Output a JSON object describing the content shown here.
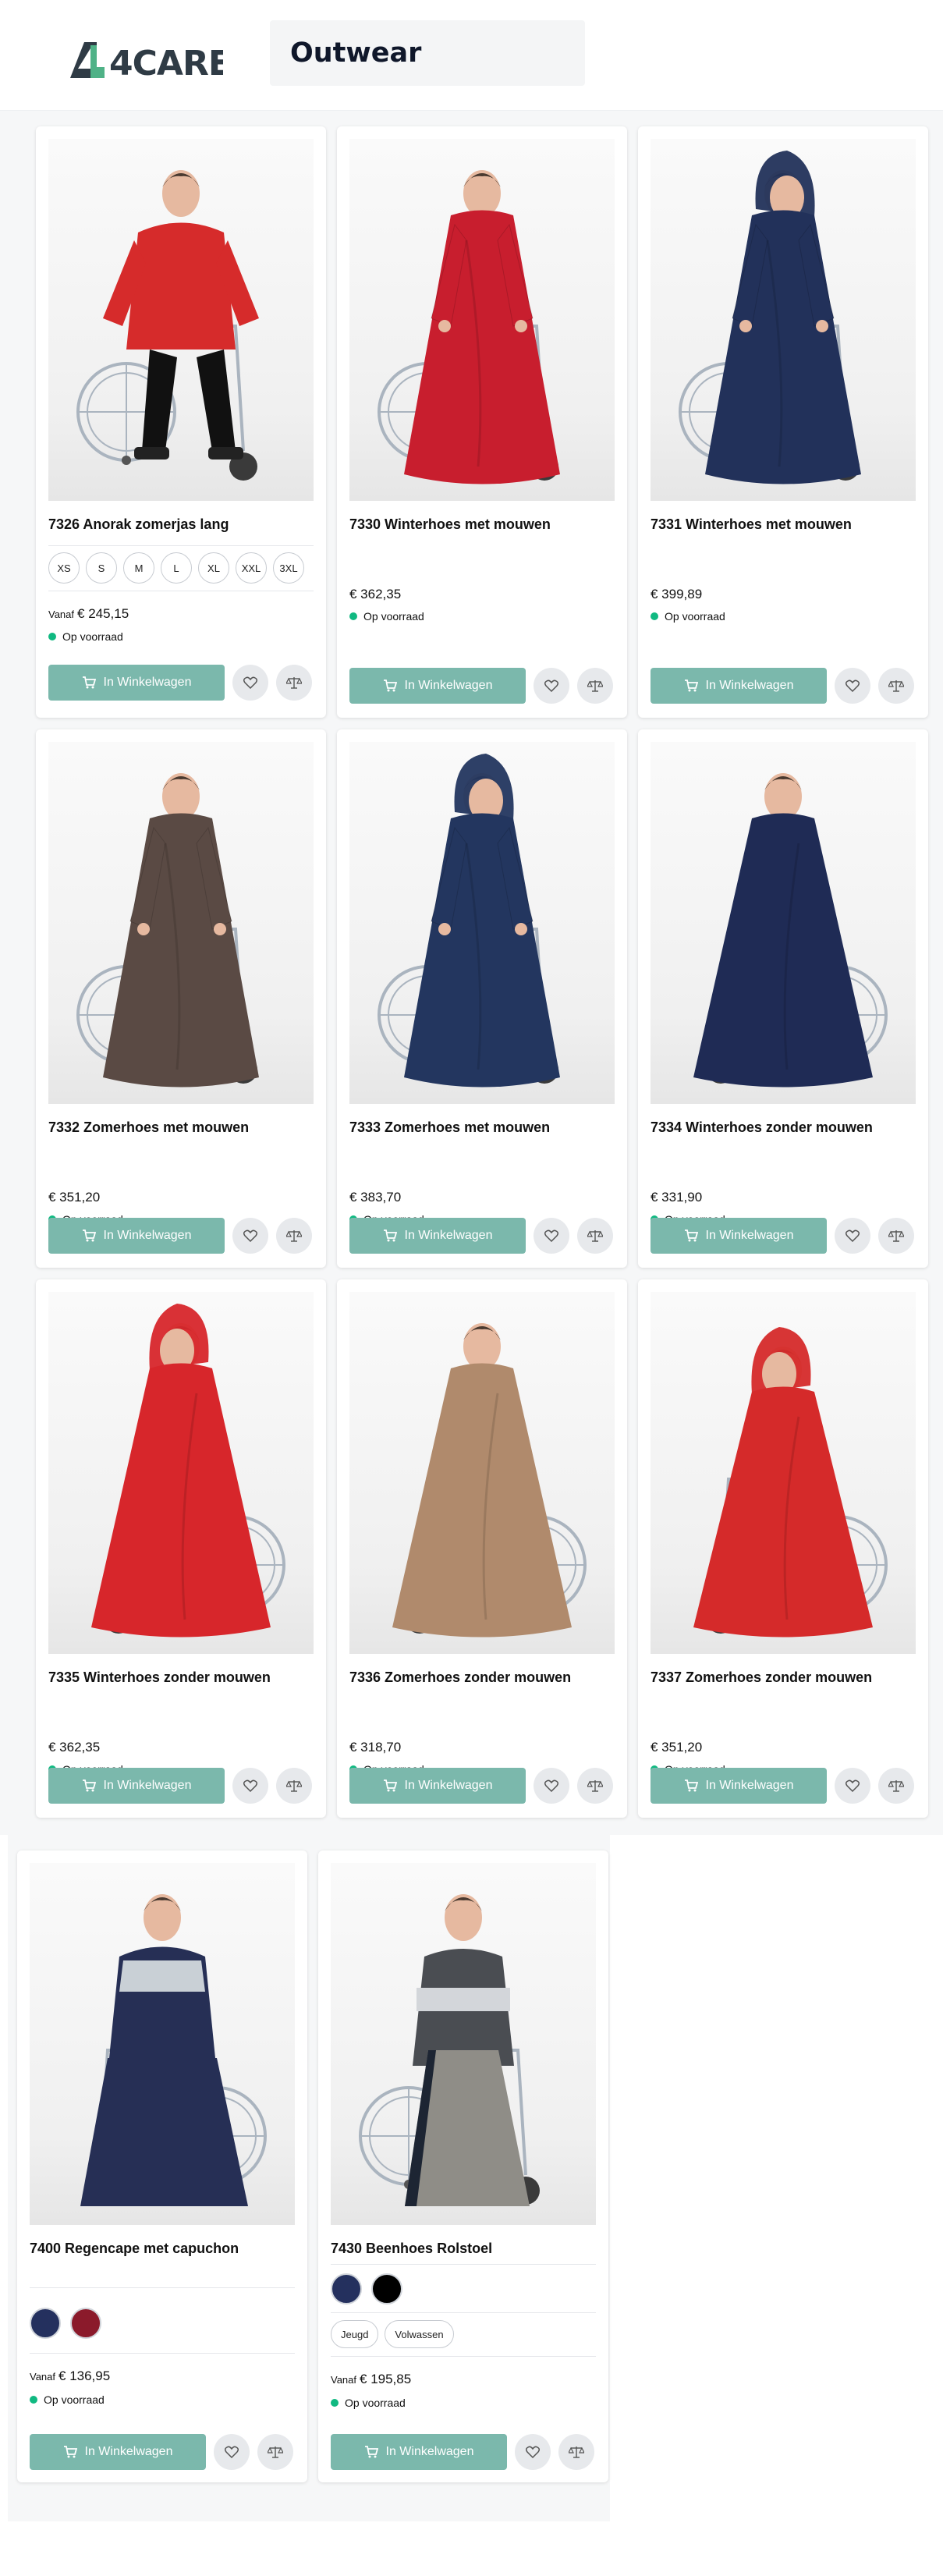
{
  "header": {
    "brand": "4CARE",
    "page_title": "Outwear"
  },
  "labels": {
    "cart": "In Winkelwagen",
    "from": "Vanaf",
    "stock": "Op voorraad"
  },
  "colors": {
    "cart_button": "#7bb8ac",
    "stock_dot": "#10b981",
    "swatch_navy": "#24305e",
    "swatch_burgundy": "#8b1a2b",
    "swatch_black": "#000000"
  },
  "products": [
    {
      "name": "7326 Anorak zomerjas lang",
      "price": "€ 245,15",
      "sizes": [
        "XS",
        "S",
        "M",
        "L",
        "XL",
        "XXL",
        "3XL"
      ]
    },
    {
      "name": "7330 Winterhoes met mouwen",
      "price": "€ 362,35"
    },
    {
      "name": "7331 Winterhoes met mouwen",
      "price": "€ 399,89"
    },
    {
      "name": "7332 Zomerhoes met mouwen",
      "price": "€ 351,20"
    },
    {
      "name": "7333 Zomerhoes met mouwen",
      "price": "€ 383,70"
    },
    {
      "name": "7334 Winterhoes zonder mouwen",
      "price": "€ 331,90"
    },
    {
      "name": "7335 Winterhoes zonder mouwen",
      "price": "€ 362,35"
    },
    {
      "name": "7336 Zomerhoes zonder mouwen",
      "price": "€ 318,70"
    },
    {
      "name": "7337 Zomerhoes zonder mouwen",
      "price": "€ 351,20"
    },
    {
      "name": "7400 Regencape met capuchon",
      "price": "€ 136,95"
    },
    {
      "name": "7430 Beenhoes Rolstoel",
      "price": "€ 195,85",
      "options": [
        "Jeugd",
        "Volwassen"
      ]
    }
  ]
}
